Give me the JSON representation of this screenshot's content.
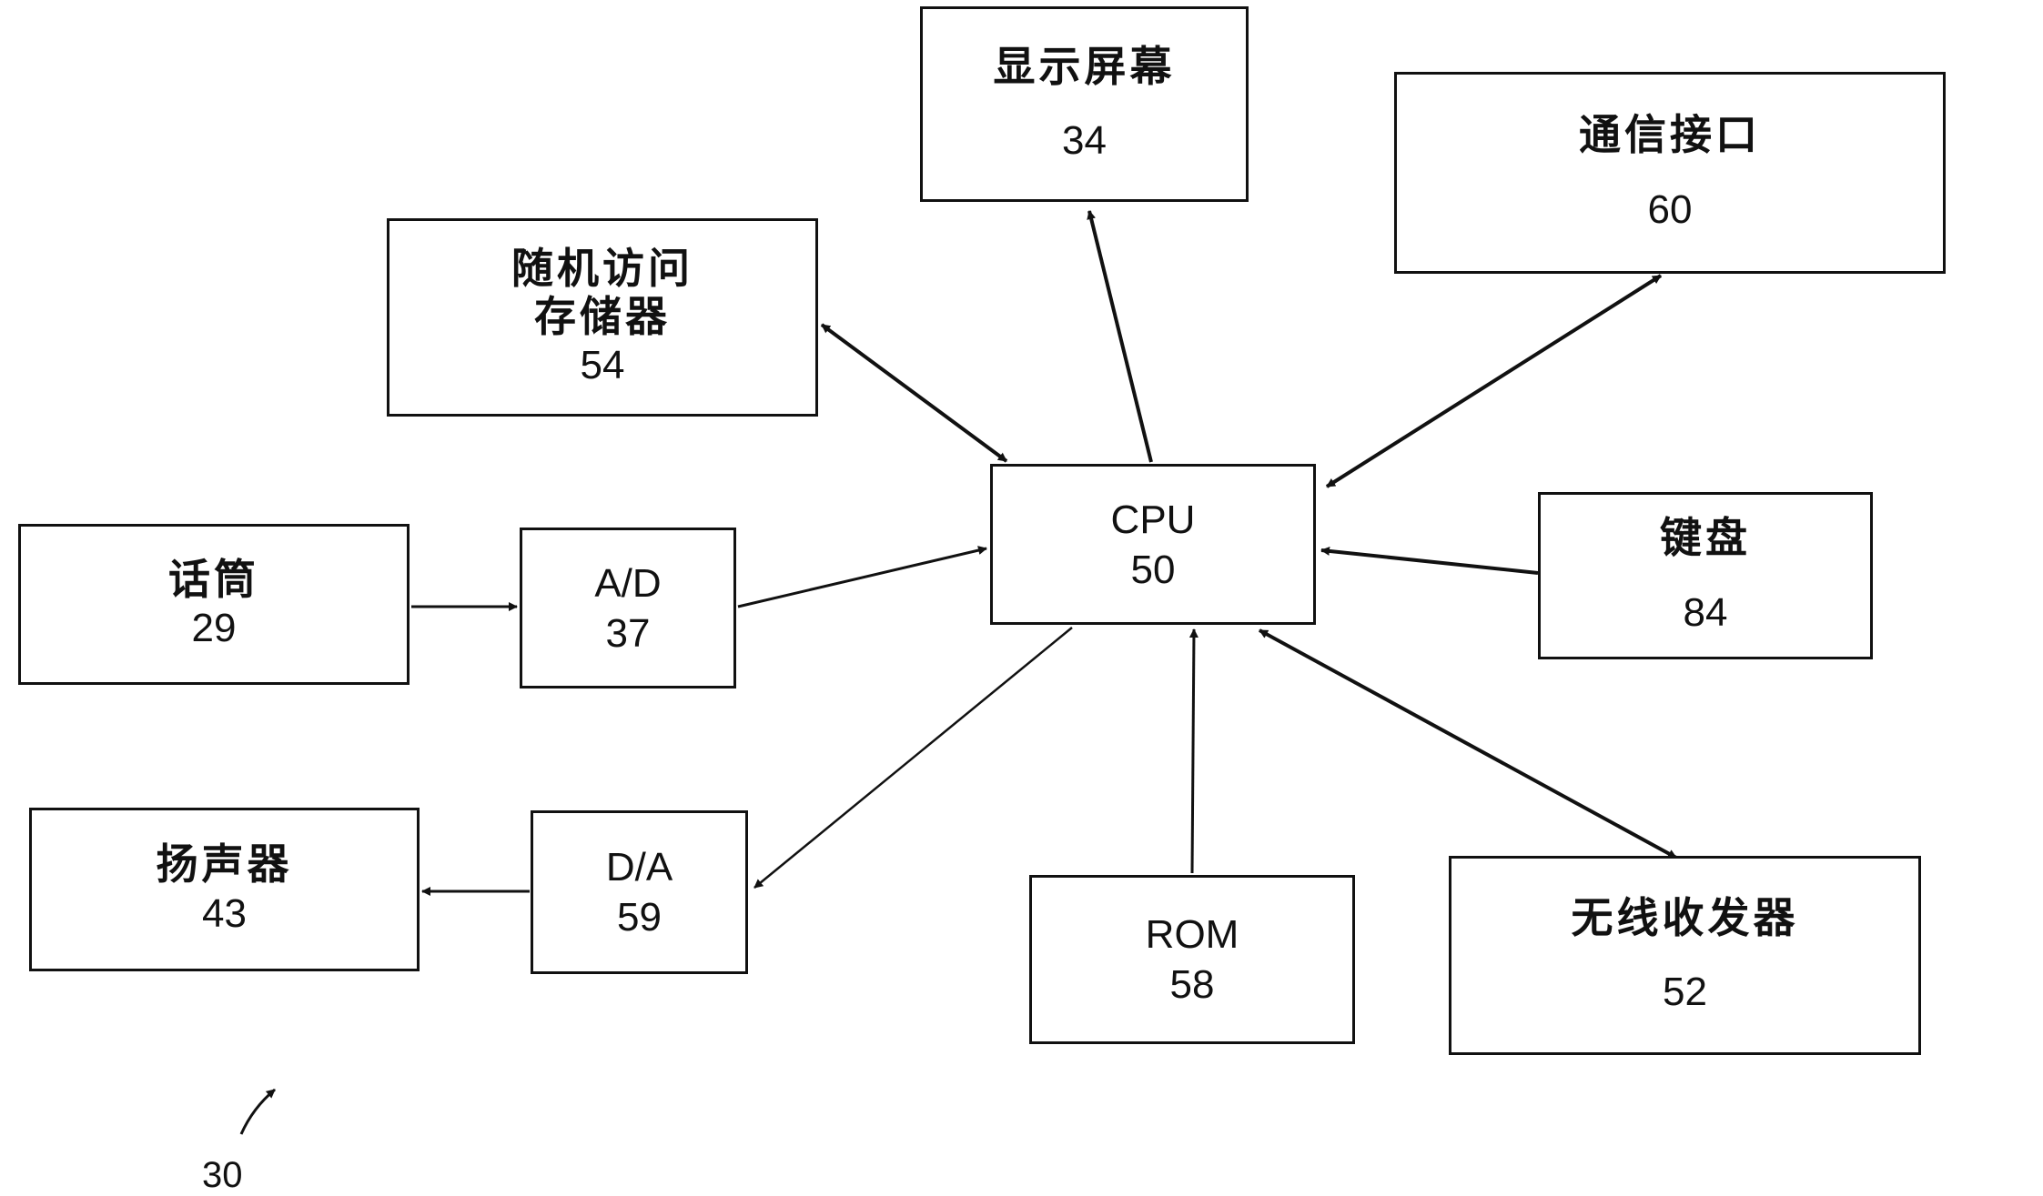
{
  "figure": {
    "reference_number": "30",
    "blocks": {
      "display": {
        "label": "显示屏幕",
        "number": "34"
      },
      "comm_interface": {
        "label": "通信接口",
        "number": "60"
      },
      "ram": {
        "label_line1": "随机访问",
        "label_line2": "存储器",
        "number": "54"
      },
      "cpu": {
        "label": "CPU",
        "number": "50"
      },
      "keyboard": {
        "label": "键盘",
        "number": "84"
      },
      "microphone": {
        "label": "话筒",
        "number": "29"
      },
      "adc": {
        "label": "A/D",
        "number": "37"
      },
      "speaker": {
        "label": "扬声器",
        "number": "43"
      },
      "dac": {
        "label": "D/A",
        "number": "59"
      },
      "rom": {
        "label": "ROM",
        "number": "58"
      },
      "wireless": {
        "label": "无线收发器",
        "number": "52"
      }
    },
    "connections": [
      {
        "from": "cpu",
        "to": "display",
        "direction": "one-way"
      },
      {
        "from": "cpu",
        "to": "comm_interface",
        "direction": "two-way"
      },
      {
        "from": "cpu",
        "to": "ram",
        "direction": "two-way"
      },
      {
        "from": "keyboard",
        "to": "cpu",
        "direction": "one-way"
      },
      {
        "from": "microphone",
        "to": "adc",
        "direction": "one-way"
      },
      {
        "from": "adc",
        "to": "cpu",
        "direction": "one-way"
      },
      {
        "from": "cpu",
        "to": "dac",
        "direction": "one-way"
      },
      {
        "from": "dac",
        "to": "speaker",
        "direction": "one-way"
      },
      {
        "from": "rom",
        "to": "cpu",
        "direction": "one-way"
      },
      {
        "from": "cpu",
        "to": "wireless",
        "direction": "two-way"
      }
    ]
  }
}
